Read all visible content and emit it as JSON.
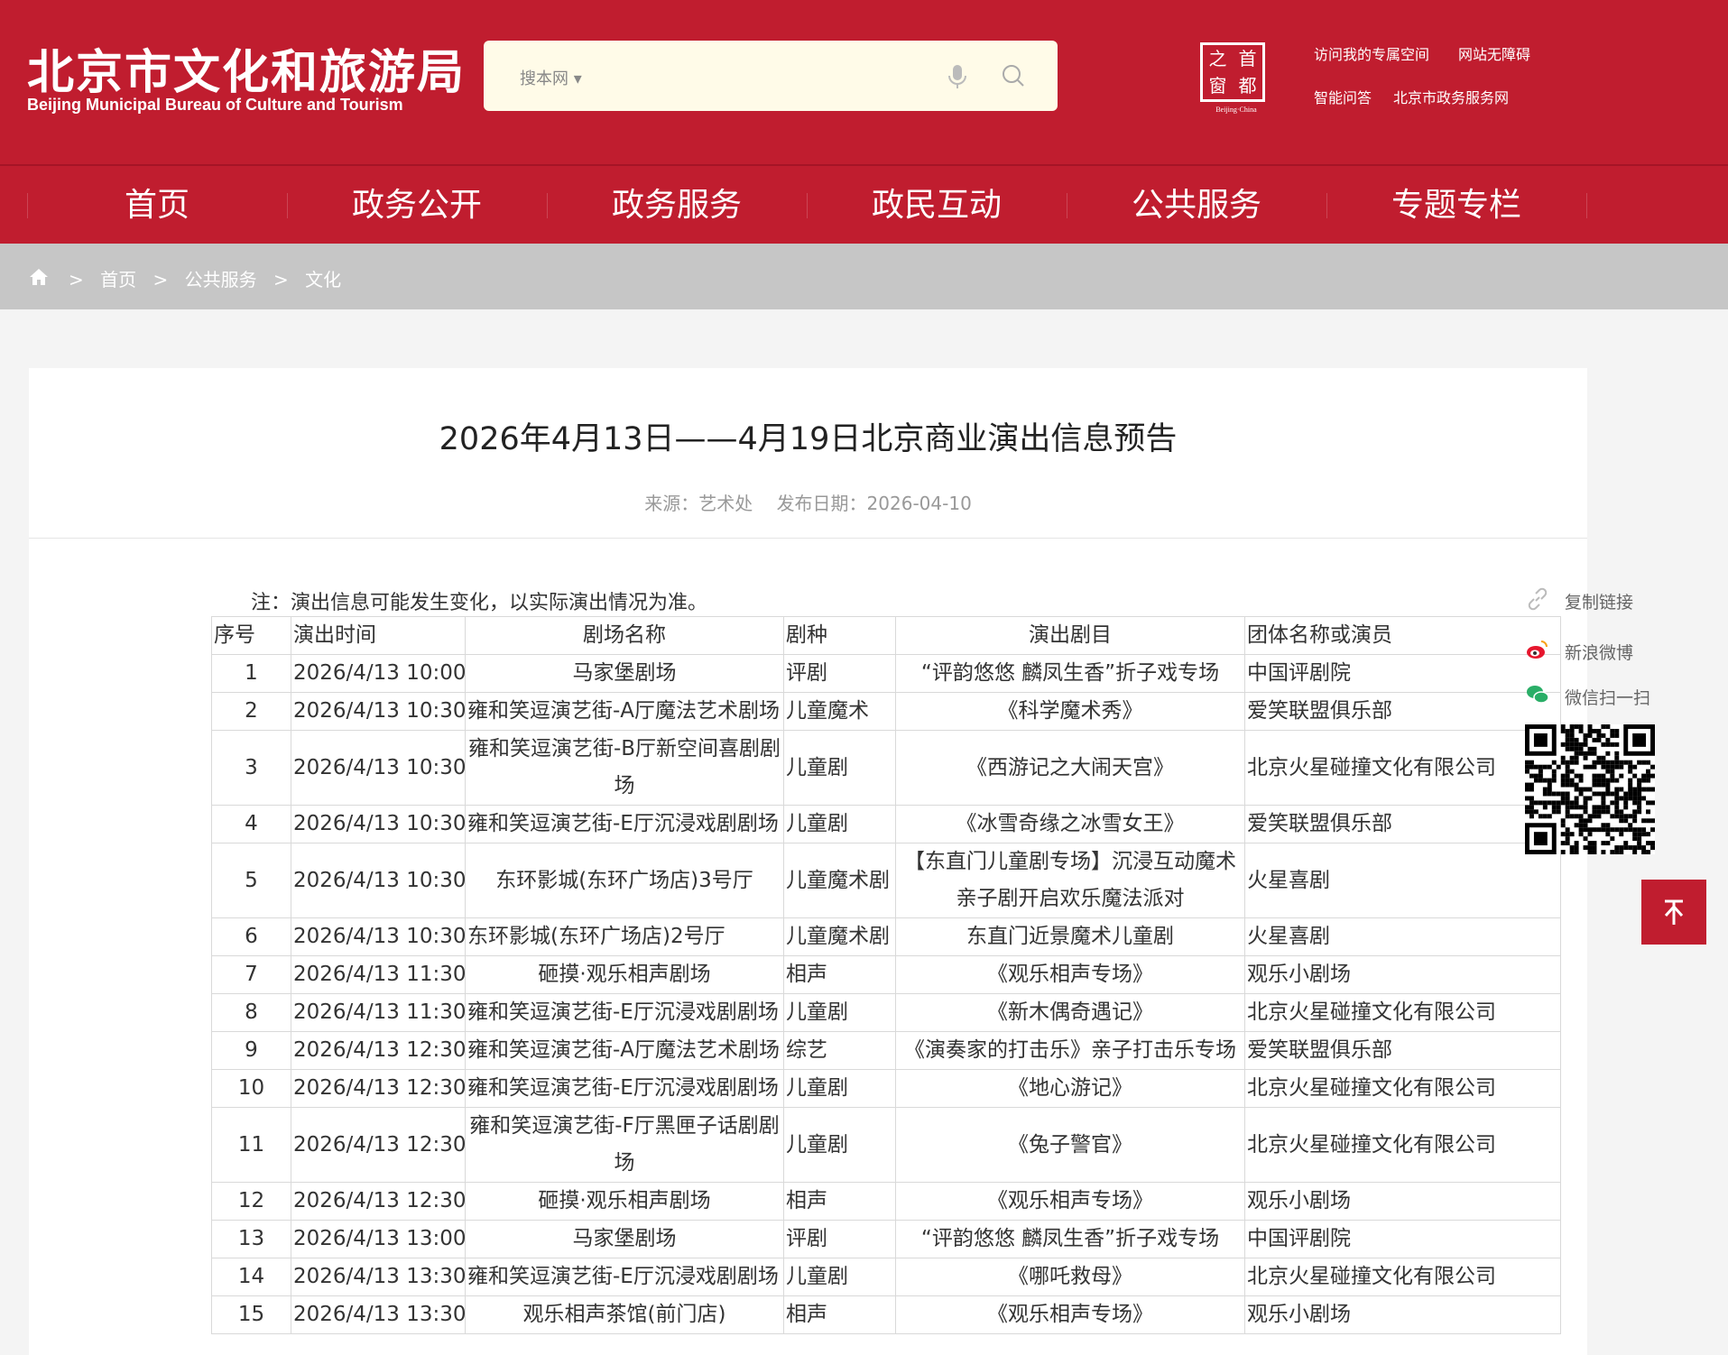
{
  "header": {
    "logo_cn": "北京市文化和旅游局",
    "logo_en": "Beijing Municipal Bureau of Culture and Tourism",
    "search_scope": "搜本网 ▾",
    "seal_chars": [
      "首",
      "都",
      "之",
      "窗"
    ],
    "seal_sub": "Beijing·China",
    "links": [
      "访问我的专属空间",
      "网站无障碍",
      "智能问答",
      "北京市政务服务网"
    ]
  },
  "nav": [
    "首页",
    "政务公开",
    "政务服务",
    "政民互动",
    "公共服务",
    "专题专栏"
  ],
  "breadcrumb": [
    "首页",
    "公共服务",
    "文化"
  ],
  "article": {
    "title": "2026年4月13日——4月19日北京商业演出信息预告",
    "source": "来源：艺术处",
    "date": "发布日期：2026-04-10",
    "note": "注：演出信息可能发生变化，以实际演出情况为准。"
  },
  "table": {
    "headers": [
      "序号",
      "演出时间",
      "剧场名称",
      "剧种",
      "演出剧目",
      "团体名称或演员"
    ],
    "rows": [
      [
        "1",
        "2026/4/13 10:00",
        "马家堡剧场",
        "评剧",
        "“评韵悠悠 麟凤生香”折子戏专场",
        "中国评剧院"
      ],
      [
        "2",
        "2026/4/13 10:30",
        "雍和笑逗演艺街-A厅魔法艺术剧场",
        "儿童魔术",
        "《科学魔术秀》",
        "爱笑联盟俱乐部"
      ],
      [
        "3",
        "2026/4/13 10:30",
        "雍和笑逗演艺街-B厅新空间喜剧剧场",
        "儿童剧",
        "《西游记之大闹天宫》",
        "北京火星碰撞文化有限公司"
      ],
      [
        "4",
        "2026/4/13 10:30",
        "雍和笑逗演艺街-E厅沉浸戏剧剧场",
        "儿童剧",
        "《冰雪奇缘之冰雪女王》",
        "爱笑联盟俱乐部"
      ],
      [
        "5",
        "2026/4/13 10:30",
        "东环影城(东环广场店)3号厅",
        "儿童魔术剧",
        "【东直门儿童剧专场】沉浸互动魔术亲子剧开启欢乐魔法派对",
        "火星喜剧"
      ],
      [
        "6",
        "2026/4/13 10:30",
        "东环影城(东环广场店)2号厅",
        "儿童魔术剧",
        "东直门近景魔术儿童剧",
        "火星喜剧"
      ],
      [
        "7",
        "2026/4/13 11:30",
        "砸摸·观乐相声剧场",
        "相声",
        "《观乐相声专场》",
        "观乐小剧场"
      ],
      [
        "8",
        "2026/4/13 11:30",
        "雍和笑逗演艺街-E厅沉浸戏剧剧场",
        "儿童剧",
        "《新木偶奇遇记》",
        "北京火星碰撞文化有限公司"
      ],
      [
        "9",
        "2026/4/13 12:30",
        "雍和笑逗演艺街-A厅魔法艺术剧场",
        "综艺",
        "《演奏家的打击乐》亲子打击乐专场",
        "爱笑联盟俱乐部"
      ],
      [
        "10",
        "2026/4/13 12:30",
        "雍和笑逗演艺街-E厅沉浸戏剧剧场",
        "儿童剧",
        "《地心游记》",
        "北京火星碰撞文化有限公司"
      ],
      [
        "11",
        "2026/4/13 12:30",
        "雍和笑逗演艺街-F厅黑匣子话剧剧场",
        "儿童剧",
        "《兔子警官》",
        "北京火星碰撞文化有限公司"
      ],
      [
        "12",
        "2026/4/13 12:30",
        "砸摸·观乐相声剧场",
        "相声",
        "《观乐相声专场》",
        "观乐小剧场"
      ],
      [
        "13",
        "2026/4/13 13:00",
        "马家堡剧场",
        "评剧",
        "“评韵悠悠 麟凤生香”折子戏专场",
        "中国评剧院"
      ],
      [
        "14",
        "2026/4/13 13:30",
        "雍和笑逗演艺街-E厅沉浸戏剧剧场",
        "儿童剧",
        "《哪吒救母》",
        "北京火星碰撞文化有限公司"
      ],
      [
        "15",
        "2026/4/13 13:30",
        "观乐相声茶馆(前门店)",
        "相声",
        "《观乐相声专场》",
        "观乐小剧场"
      ]
    ]
  },
  "share": {
    "copy_link": "复制链接",
    "weibo": "新浪微博",
    "wechat": "微信扫一扫"
  },
  "colors": {
    "brand_red": "#c01d2f",
    "breadcrumb_bg": "#c6c6c6",
    "search_bg": "#fffbe8"
  },
  "icons": [
    "home-icon",
    "microphone-icon",
    "search-icon",
    "link-icon",
    "weibo-icon",
    "wechat-icon",
    "qr-code",
    "back-to-top-icon"
  ]
}
